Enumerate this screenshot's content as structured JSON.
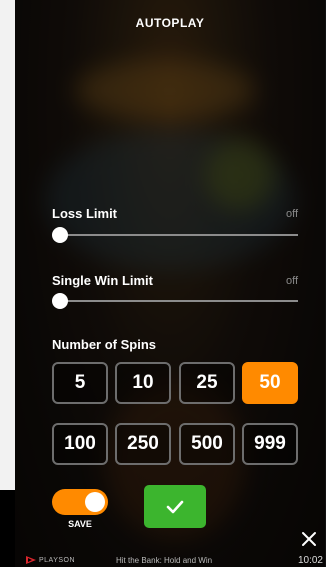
{
  "title": "AUTOPLAY",
  "loss_limit": {
    "label": "Loss Limit",
    "value": "off"
  },
  "single_win_limit": {
    "label": "Single Win Limit",
    "value": "off"
  },
  "spins": {
    "label": "Number of Spins",
    "options": [
      "5",
      "10",
      "25",
      "50",
      "100",
      "250",
      "500",
      "999"
    ],
    "selected": "50"
  },
  "save": {
    "label": "SAVE",
    "enabled": true
  },
  "confirm": {
    "icon": "check-icon"
  },
  "close": {
    "icon": "close-icon"
  },
  "footer": {
    "brand": "PLAYSON",
    "game_title": "Hit the Bank: Hold and Win",
    "time": "10:02"
  },
  "colors": {
    "accent": "#ff8a00",
    "confirm": "#3cb52e",
    "muted": "#8a8a8a"
  }
}
